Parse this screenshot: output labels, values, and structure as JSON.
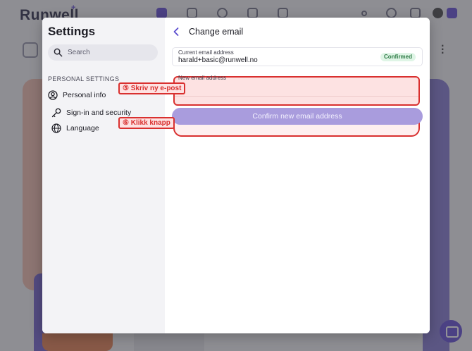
{
  "background_app": {
    "logo": "Runwell",
    "logo_sup": "+"
  },
  "sidebar": {
    "title": "Settings",
    "search_placeholder": "Search",
    "section_label": "PERSONAL SETTINGS",
    "items": [
      {
        "label": "Personal info",
        "icon": "user-circle-icon"
      },
      {
        "label": "Sign-in and security",
        "icon": "key-icon"
      },
      {
        "label": "Language",
        "icon": "globe-icon"
      }
    ]
  },
  "main": {
    "title": "Change email",
    "current_email": {
      "label": "Current email address",
      "value": "harald+basic@runwell.no",
      "badge": "Confirmed"
    },
    "new_email": {
      "label": "New email address",
      "value": ""
    },
    "confirm_button": "Confirm new email address"
  },
  "annotations": [
    {
      "text": "⑤ Skriv ny e-post"
    },
    {
      "text": "⑥ Klikk knapp"
    }
  ],
  "colors": {
    "accent": "#6f5bd8",
    "confirm_button": "#a99cdd",
    "annotation_red": "#d9302f",
    "badge_bg": "#dff5e6",
    "badge_text": "#2d7a45"
  }
}
